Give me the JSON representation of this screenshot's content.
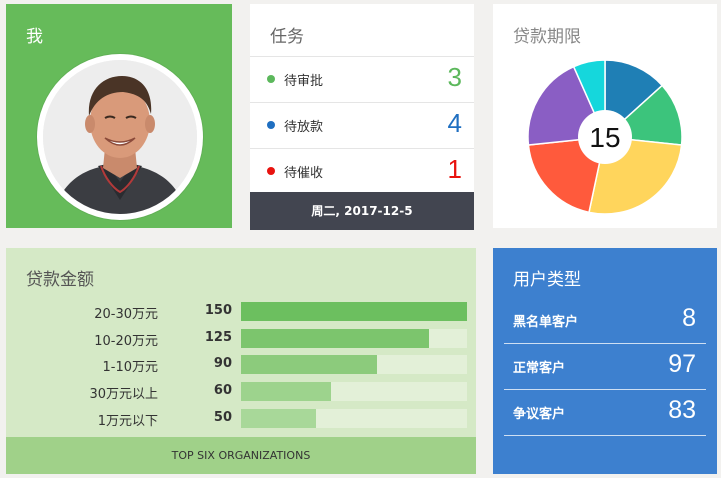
{
  "me": {
    "title": "我"
  },
  "tasks": {
    "title": "任务",
    "items": [
      {
        "label": "待审批",
        "count": "3",
        "color": "#5cb85c"
      },
      {
        "label": "待放款",
        "count": "4",
        "color": "#1f6fc1"
      },
      {
        "label": "待催收",
        "count": "1",
        "color": "#e8130f"
      }
    ],
    "date": "周二, 2017-12-5"
  },
  "term": {
    "title": "贷款期限",
    "center_value": "15",
    "slices": [
      {
        "value": 2,
        "color": "#1f7fb5"
      },
      {
        "value": 2,
        "color": "#3cc47c"
      },
      {
        "value": 4,
        "color": "#ffd55c"
      },
      {
        "value": 3,
        "color": "#ff5a3c"
      },
      {
        "value": 3,
        "color": "#8a5ec4"
      },
      {
        "value": 1,
        "color": "#15d7dc"
      }
    ]
  },
  "amount": {
    "title": "贷款金额",
    "max": 150,
    "rows": [
      {
        "label": "20-30万元",
        "value": 150,
        "color": "#6cbf5f"
      },
      {
        "label": "10-20万元",
        "value": 125,
        "color": "#7cc56d"
      },
      {
        "label": "1-10万元",
        "value": 90,
        "color": "#8ccb7c"
      },
      {
        "label": "30万元以上",
        "value": 60,
        "color": "#9dd38d"
      },
      {
        "label": "1万元以下",
        "value": 50,
        "color": "#a8d899"
      }
    ],
    "footer": "TOP SIX ORGANIZATIONS"
  },
  "users": {
    "title": "用户类型",
    "items": [
      {
        "label": "黑名单客户",
        "value": "8"
      },
      {
        "label": "正常客户",
        "value": "97"
      },
      {
        "label": "争议客户",
        "value": "83"
      }
    ]
  }
}
